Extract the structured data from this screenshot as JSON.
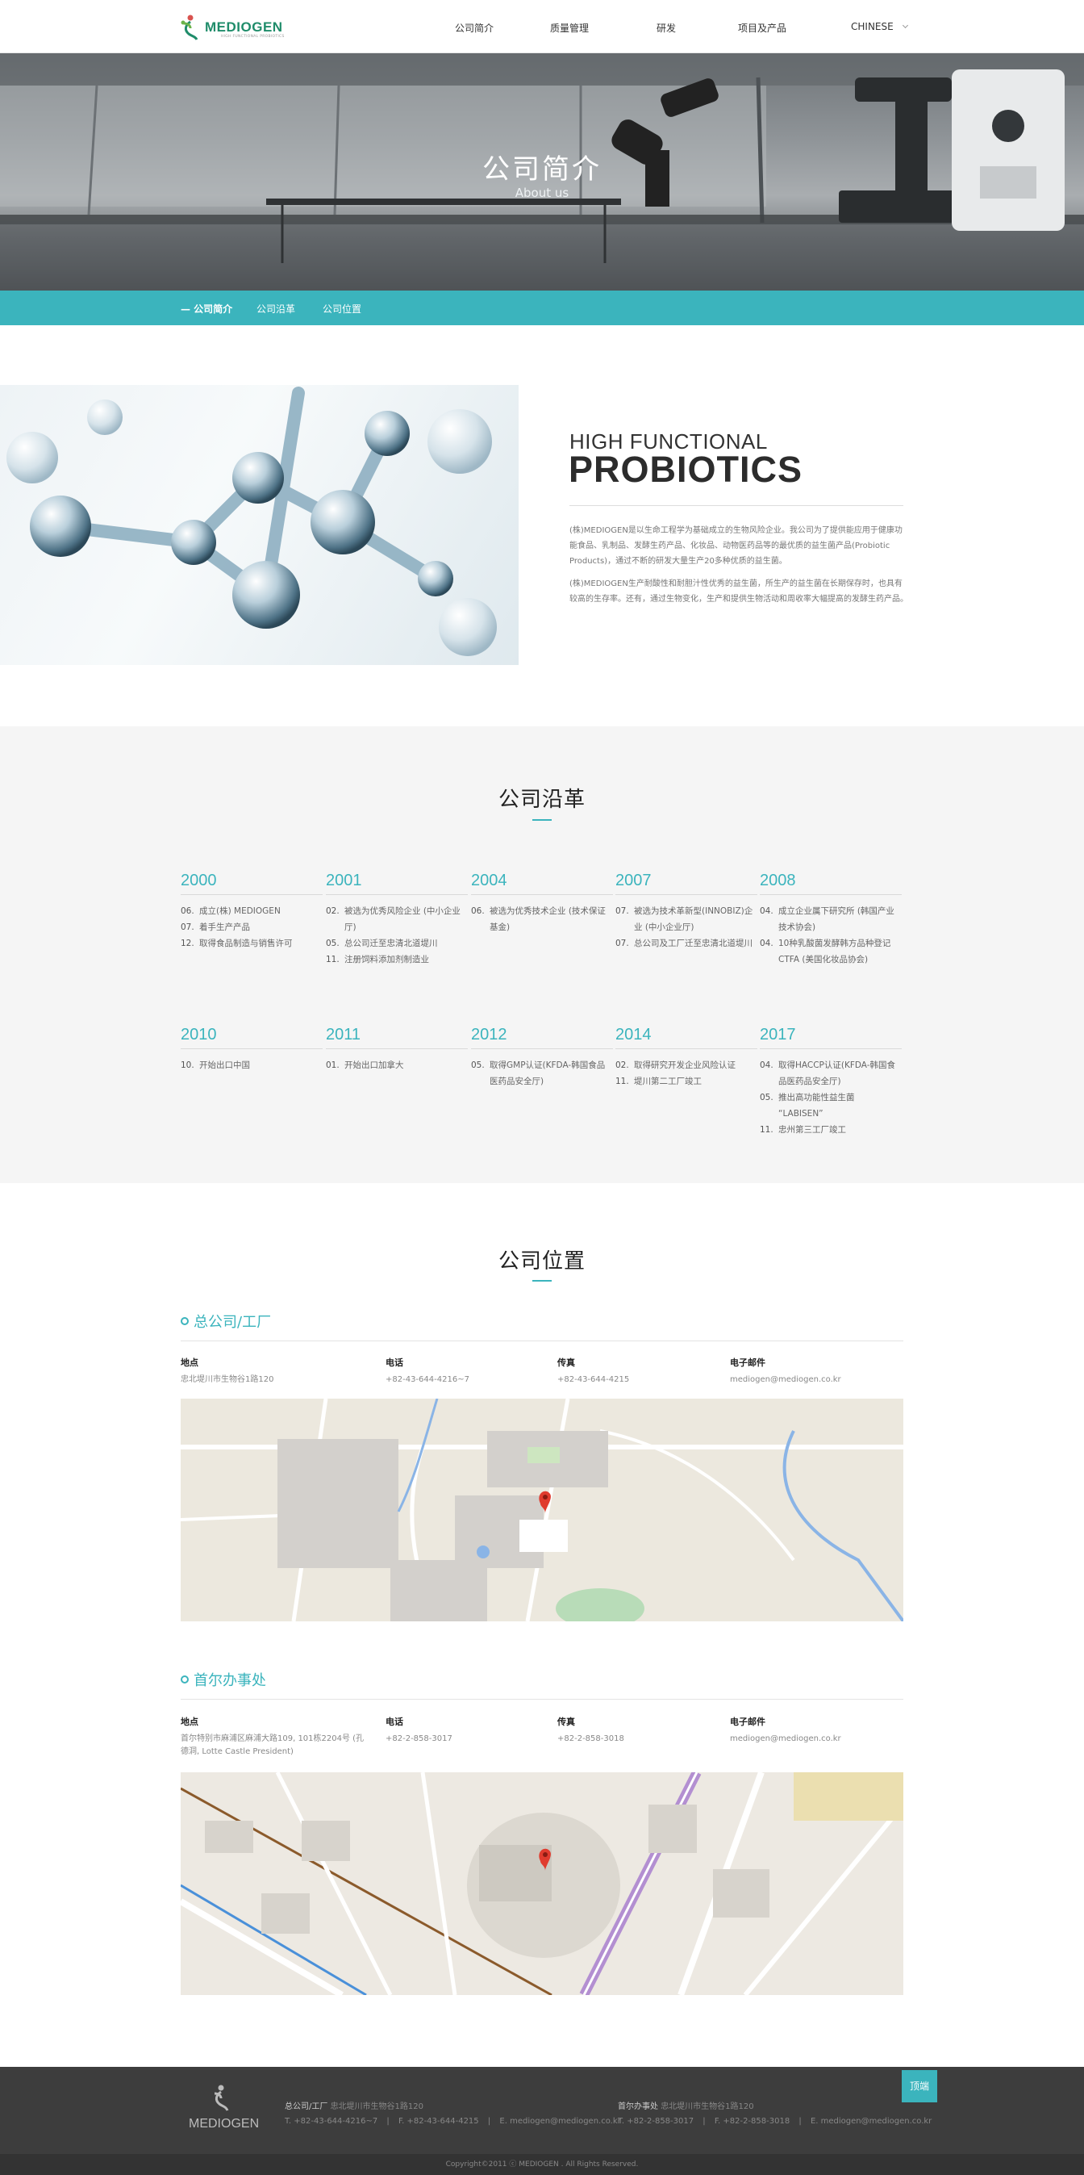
{
  "header": {
    "logo_text": "MEDIOGEN",
    "logo_sub": "HIGH FUNCTIONAL PROBIOTICS",
    "nav": [
      "公司简介",
      "质量管理",
      "研发",
      "项目及产品"
    ],
    "lang": "CHINESE"
  },
  "hero": {
    "title": "公司简介",
    "subtitle": "About us"
  },
  "subnav": [
    "— 公司简介",
    "公司沿革",
    "公司位置"
  ],
  "intro": {
    "line1": "HIGH FUNCTIONAL",
    "line2": "PROBIOTICS",
    "p1": "(株)MEDIOGEN是以生命工程学为基础成立的生物风险企业。我公司为了提供能应用于健康功能食品、乳制品、发酵生药产品、化妆品、动物医药品等的最优质的益生菌产品(Probiotic Products)，通过不断的研发大量生产20多种优质的益生菌。",
    "p2": "(株)MEDIOGEN生产耐酸性和耐胆汁性优秀的益生菌，所生产的益生菌在长期保存时，也具有较高的生存率。还有，通过生物变化，生产和提供生物活动和周收率大幅提高的发酵生药产品。"
  },
  "history": {
    "title": "公司沿革",
    "rows": [
      [
        {
          "year": "2000",
          "events": [
            {
              "m": "06.",
              "t": "成立(株) MEDIOGEN"
            },
            {
              "m": "07.",
              "t": "着手生产产品"
            },
            {
              "m": "12.",
              "t": "取得食品制造与销售许可"
            }
          ]
        },
        {
          "year": "2001",
          "events": [
            {
              "m": "02.",
              "t": "被选为优秀风险企业 (中小企业厅)"
            },
            {
              "m": "05.",
              "t": "总公司迁至忠清北道堤川"
            },
            {
              "m": "11.",
              "t": "注册饲料添加剂制造业"
            }
          ]
        },
        {
          "year": "2004",
          "events": [
            {
              "m": "06.",
              "t": "被选为优秀技术企业 (技术保证基金)"
            }
          ]
        },
        {
          "year": "2007",
          "events": [
            {
              "m": "07.",
              "t": "被选为技术革新型(INNOBIZ)企业 (中小企业厅)"
            },
            {
              "m": "07.",
              "t": "总公司及工厂迁至忠清北道堤川"
            }
          ]
        },
        {
          "year": "2008",
          "events": [
            {
              "m": "04.",
              "t": "成立企业属下研究所 (韩国产业技术协会)"
            },
            {
              "m": "04.",
              "t": "10种乳酸菌发酵韩方品种登记CTFA (美国化妆品协会)"
            }
          ]
        }
      ],
      [
        {
          "year": "2010",
          "events": [
            {
              "m": "10.",
              "t": "开始出口中国"
            }
          ]
        },
        {
          "year": "2011",
          "events": [
            {
              "m": "01.",
              "t": "开始出口加拿大"
            }
          ]
        },
        {
          "year": "2012",
          "events": [
            {
              "m": "05.",
              "t": "取得GMP认证(KFDA-韩国食品医药品安全厅)"
            }
          ]
        },
        {
          "year": "2014",
          "events": [
            {
              "m": "02.",
              "t": "取得研究开发企业风险认证"
            },
            {
              "m": "11.",
              "t": "堤川第二工厂竣工"
            }
          ]
        },
        {
          "year": "2017",
          "events": [
            {
              "m": "04.",
              "t": "取得HACCP认证(KFDA-韩国食品医药品安全厅)"
            },
            {
              "m": "05.",
              "t": "推出高功能性益生菌 “LABISEN”"
            },
            {
              "m": "11.",
              "t": "忠州第三工厂竣工"
            }
          ]
        }
      ]
    ]
  },
  "location": {
    "title": "公司位置",
    "hq": {
      "title": "总公司/工厂",
      "addr_label": "地点",
      "addr": "忠北堤川市生物谷1路120",
      "tel_label": "电话",
      "tel": "+82-43-644-4216~7",
      "fax_label": "传真",
      "fax": "+82-43-644-4215",
      "email_label": "电子邮件",
      "email": "mediogen@mediogen.co.kr"
    },
    "seoul": {
      "title": "首尔办事处",
      "addr_label": "地点",
      "addr": "首尔特别市麻浦区麻浦大路109, 101栋2204号 (孔德洞, Lotte Castle President)",
      "tel_label": "电话",
      "tel": "+82-2-858-3017",
      "fax_label": "传真",
      "fax": "+82-2-858-3018",
      "email_label": "电子邮件",
      "email": "mediogen@mediogen.co.kr"
    }
  },
  "footer": {
    "logo_text": "MEDIOGEN",
    "hq_label": "总公司/工厂",
    "hq_addr": "忠北堤川市生物谷1路120",
    "hq_tel": "T. +82-43-644-4216~7",
    "hq_fax": "F. +82-43-644-4215",
    "hq_email": "E. mediogen@mediogen.co.kr",
    "seoul_label": "首尔办事处",
    "seoul_addr": "忠北堤川市生物谷1路120",
    "seoul_tel": "T. +82-2-858-3017",
    "seoul_fax": "F. +82-2-858-3018",
    "seoul_email": "E. mediogen@mediogen.co.kr",
    "top_label": "顶端",
    "copyright": "Copyright©2011 ⓒ MEDIOGEN . All Rights Reserved."
  },
  "colors": {
    "accent": "#3bb4bd",
    "logo_green": "#1f8c6a",
    "footer_bg": "#3d3d3d"
  }
}
